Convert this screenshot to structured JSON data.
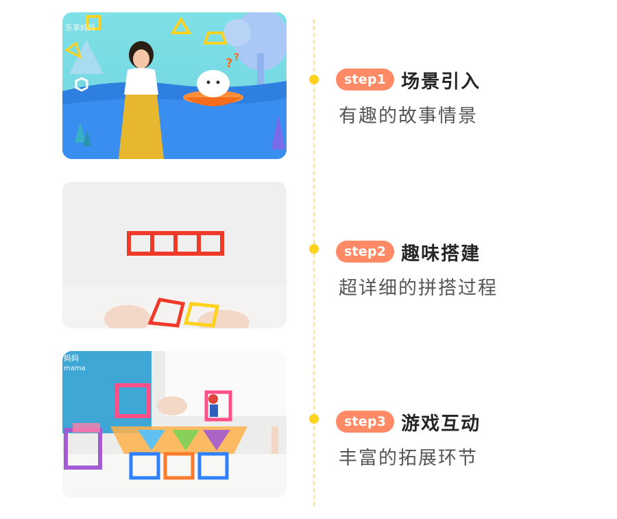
{
  "steps": [
    {
      "badge": "step1",
      "title": "场景引入",
      "desc": "有趣的故事情景"
    },
    {
      "badge": "step2",
      "title": "趣味搭建",
      "desc": "超详细的拼搭过程"
    },
    {
      "badge": "step3",
      "title": "游戏互动",
      "desc": "丰富的拓展环节"
    }
  ],
  "watermarks": {
    "card1": "乐享妈妈",
    "card3_top": "妈妈",
    "card3_bottom": "mama"
  },
  "colors": {
    "badge": "#ff8a65",
    "timeline": "#ffe08a",
    "dot": "#ffd21f"
  }
}
